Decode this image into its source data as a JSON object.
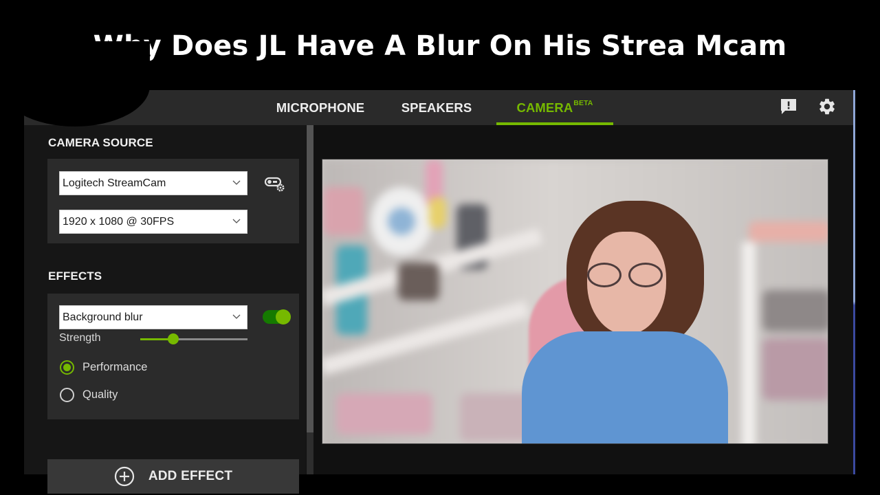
{
  "headline": "Why Does JL Have A Blur On His Strea Mcam",
  "app": {
    "tabs": [
      {
        "label": "MICROPHONE",
        "active": false
      },
      {
        "label": "SPEAKERS",
        "active": false
      },
      {
        "label": "CAMERA",
        "superscript": "BETA",
        "active": true
      }
    ],
    "header_icons": [
      "feedback-icon",
      "settings-gear-icon"
    ],
    "accent_color": "#76b900"
  },
  "camera_source": {
    "title": "CAMERA SOURCE",
    "device_select": {
      "value": "Logitech StreamCam"
    },
    "resolution_select": {
      "value": "1920 x 1080 @ 30FPS"
    },
    "camera_settings_icon": "camera-settings-icon"
  },
  "effects": {
    "title": "EFFECTS",
    "effect_select": {
      "value": "Background blur"
    },
    "enabled": true,
    "strength_label": "Strength",
    "strength_value": 0.31,
    "modes": [
      {
        "label": "Performance",
        "selected": true
      },
      {
        "label": "Quality",
        "selected": false
      }
    ],
    "add_effect_label": "ADD EFFECT"
  },
  "scrollbar": {
    "visible_fraction": 0.88,
    "position": 0.0
  },
  "preview": {
    "description": "webcam preview with blurred background"
  }
}
